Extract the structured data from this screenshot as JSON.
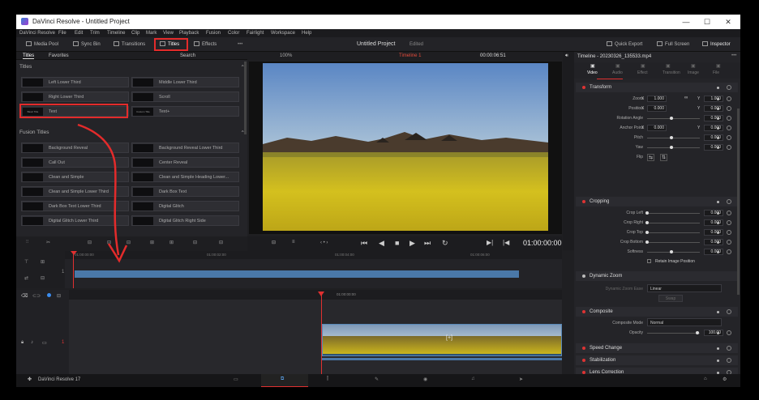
{
  "window": {
    "title": "DaVinci Resolve - Untitled Project",
    "min": "—",
    "max": "☐",
    "close": "✕"
  },
  "menu": [
    "DaVinci Resolve",
    "File",
    "Edit",
    "Trim",
    "Timeline",
    "Clip",
    "Mark",
    "View",
    "Playback",
    "Fusion",
    "Color",
    "Fairlight",
    "Workspace",
    "Help"
  ],
  "toolbar": {
    "media_pool": "Media Pool",
    "sync_bin": "Sync Bin",
    "transitions": "Transitions",
    "titles": "Titles",
    "effects": "Effects",
    "project": "Untitled Project",
    "status": "Edited",
    "quick_export": "Quick Export",
    "full_screen": "Full Screen",
    "inspector": "Inspector"
  },
  "left": {
    "tab_titles": "Titles",
    "tab_favorites": "Favorites",
    "search": "Search",
    "sec_titles": "Titles",
    "sec_fusion": "Fusion Titles",
    "titles": [
      {
        "thumb": "",
        "label": "Left Lower Third"
      },
      {
        "thumb": "",
        "label": "Middle Lower Third"
      },
      {
        "thumb": "",
        "label": "Right Lower Third"
      },
      {
        "thumb": "",
        "label": "Scroll"
      },
      {
        "thumb": "Basic Title",
        "label": "Text"
      },
      {
        "thumb": "Custom Title",
        "label": "Text+"
      }
    ],
    "fusion": [
      {
        "thumb": "",
        "label": "Background Reveal"
      },
      {
        "thumb": "",
        "label": "Background Reveal Lower Third"
      },
      {
        "thumb": "",
        "label": "Call Out"
      },
      {
        "thumb": "",
        "label": "Center Reveal"
      },
      {
        "thumb": "",
        "label": "Clean and Simple"
      },
      {
        "thumb": "",
        "label": "Clean and Simple Heading Lower..."
      },
      {
        "thumb": "",
        "label": "Clean and Simple Lower Third"
      },
      {
        "thumb": "",
        "label": "Dark Box Text"
      },
      {
        "thumb": "",
        "label": "Dark Box Text Lower Third"
      },
      {
        "thumb": "",
        "label": "Digital Glitch"
      },
      {
        "thumb": "",
        "label": "Digital Glitch Lower Third"
      },
      {
        "thumb": "",
        "label": "Digital Glitch Right Side"
      }
    ]
  },
  "viewer": {
    "zoom": "100%",
    "timeline": "Timeline 1",
    "source_tc": "00:00:06:51",
    "timecode": "01:00:00:00"
  },
  "timeline": {
    "ruler_mini": [
      "01:00:00:00",
      "01:00:02:00",
      "01:00:04:00",
      "01:00:06:00"
    ],
    "ruler_main": [
      "01:00:00:00"
    ],
    "track1": "1"
  },
  "inspector": {
    "clip": "Timeline - 20230326_135533.mp4",
    "tabs": [
      "Video",
      "Audio",
      "Effect",
      "Transition",
      "Image",
      "File"
    ],
    "transform": {
      "title": "Transform",
      "zoom_label": "Zoom",
      "zoom_x": "1.000",
      "zoom_y": "1.000",
      "pos_label": "Position",
      "pos_x": "0.000",
      "pos_y": "0.000",
      "rot_label": "Rotation Angle",
      "rot": "0.000",
      "anchor_label": "Anchor Point",
      "anc_x": "0.000",
      "anc_y": "0.000",
      "pitch_label": "Pitch",
      "pitch": "0.000",
      "yaw_label": "Yaw",
      "yaw": "0.000",
      "flip_label": "Flip",
      "x": "X",
      "y": "Y"
    },
    "cropping": {
      "title": "Cropping",
      "left_label": "Crop Left",
      "left": "0.000",
      "right_label": "Crop Right",
      "right": "0.000",
      "top_label": "Crop Top",
      "top": "0.000",
      "bottom_label": "Crop Bottom",
      "bottom": "0.000",
      "soft_label": "Softness",
      "soft": "0.000",
      "retain": "Retain Image Position"
    },
    "dynamic_zoom": {
      "title": "Dynamic Zoom",
      "ease_label": "Dynamic Zoom Ease",
      "ease": "Linear",
      "swap": "Swap"
    },
    "composite": {
      "title": "Composite",
      "mode_label": "Composite Mode",
      "mode": "Normal",
      "opacity_label": "Opacity",
      "opacity": "100.00"
    },
    "speed": "Speed Change",
    "stab": "Stabilization",
    "lens": {
      "title": "Lens Correction",
      "analyze": "Analyze",
      "dist_label": "Distortion",
      "dist": "0.000"
    }
  },
  "bottom": {
    "app": "DaVinci Resolve 17"
  },
  "colors": {
    "accent_red": "#e32b2b",
    "clip_blue": "#4a78a8",
    "playhead": "#e03030"
  }
}
